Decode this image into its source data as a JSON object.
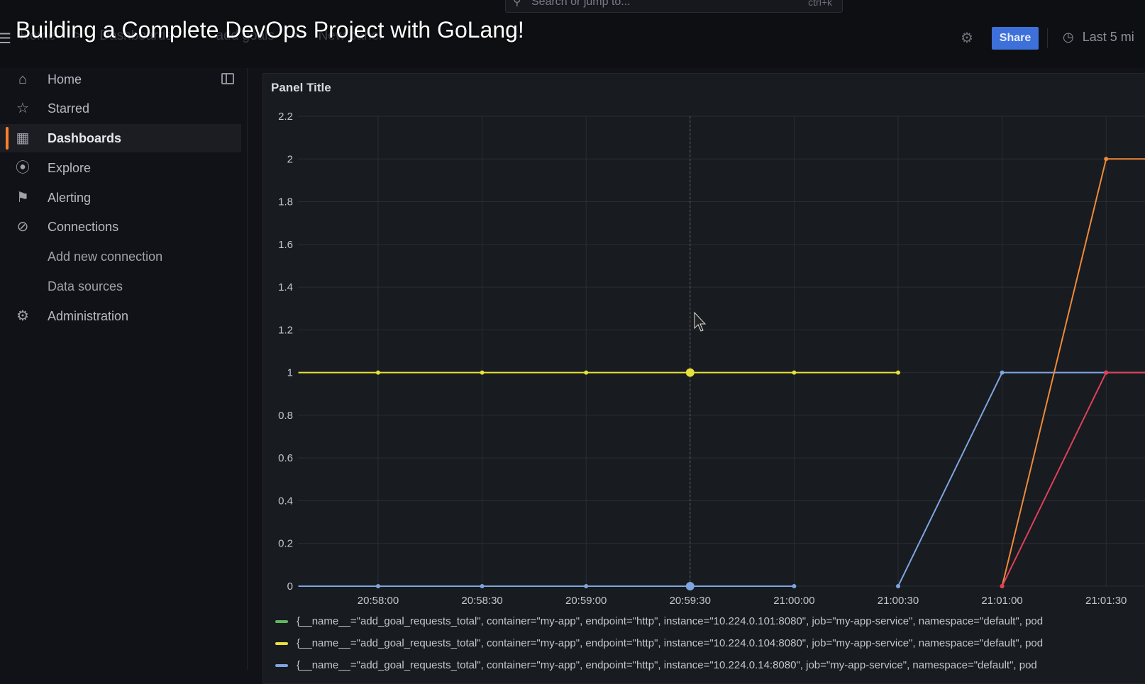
{
  "video_title": "Building a Complete DevOps Project with GoLang!",
  "topbar": {
    "search_placeholder": "Search or jump to...",
    "search_shortcut": "ctrl+k",
    "breadcrumb": [
      "Home",
      ">",
      "Dashboards",
      ">",
      "add goals",
      ">",
      "New panel"
    ],
    "share_label": "Share",
    "time_range": "Last 5 mi"
  },
  "sidebar": {
    "items": [
      {
        "label": "Home",
        "icon": "home-icon"
      },
      {
        "label": "Starred",
        "icon": "star-icon"
      },
      {
        "label": "Dashboards",
        "icon": "grid-icon",
        "active": true
      },
      {
        "label": "Explore",
        "icon": "compass-icon"
      },
      {
        "label": "Alerting",
        "icon": "bell-icon"
      },
      {
        "label": "Connections",
        "icon": "plug-icon"
      },
      {
        "label": "Add new connection"
      },
      {
        "label": "Data sources"
      },
      {
        "label": "Administration",
        "icon": "gear-icon"
      }
    ]
  },
  "panel": {
    "title": "Panel Title"
  },
  "colors": {
    "series_yellow": "#e6e13a",
    "series_blue": "#7ea5e0",
    "series_orange": "#ef8a3a",
    "series_red": "#e0405a",
    "series_green": "#5fb85f",
    "accent": "#ff7f2a",
    "share_button": "#3d71d9"
  },
  "chart_data": {
    "type": "line",
    "title": "Panel Title",
    "x_ticks": [
      "20:58:00",
      "20:58:30",
      "20:59:00",
      "20:59:30",
      "21:00:00",
      "21:00:30",
      "21:01:00",
      "21:01:30"
    ],
    "y_ticks": [
      "0",
      "0.2",
      "0.4",
      "0.6",
      "0.8",
      "1",
      "1.2",
      "1.4",
      "1.6",
      "1.8",
      "2",
      "2.2"
    ],
    "ylim": [
      0,
      2.2
    ],
    "grid": true,
    "legend_placement": "bottom",
    "series": [
      {
        "color": "yellow",
        "x": [
          "20:57:37",
          "20:58:00",
          "20:58:30",
          "20:59:00",
          "20:59:30",
          "21:00:00",
          "21:00:30"
        ],
        "values": [
          1,
          1,
          1,
          1,
          1,
          1,
          1
        ]
      },
      {
        "color": "blue",
        "x": [
          "20:57:37",
          "20:58:00",
          "20:58:30",
          "20:59:00",
          "20:59:30",
          "21:00:00"
        ],
        "values": [
          0,
          0,
          0,
          0,
          0,
          0
        ]
      },
      {
        "color": "blue",
        "x": [
          "21:00:30",
          "21:01:00",
          "21:01:30",
          "21:01:42"
        ],
        "values": [
          0,
          1,
          1,
          1
        ]
      },
      {
        "color": "orange",
        "x": [
          "21:01:00",
          "21:01:30",
          "21:01:42"
        ],
        "values": [
          0,
          2,
          2
        ]
      },
      {
        "color": "red",
        "x": [
          "21:01:00",
          "21:01:30",
          "21:01:42"
        ],
        "values": [
          0,
          1,
          1
        ]
      }
    ],
    "legend": [
      {
        "color": "green",
        "text": "{__name__=\"add_goal_requests_total\", container=\"my-app\", endpoint=\"http\", instance=\"10.224.0.101:8080\", job=\"my-app-service\", namespace=\"default\", pod"
      },
      {
        "color": "yellow",
        "text": "{__name__=\"add_goal_requests_total\", container=\"my-app\", endpoint=\"http\", instance=\"10.224.0.104:8080\", job=\"my-app-service\", namespace=\"default\", pod"
      },
      {
        "color": "blue",
        "text": "{__name__=\"add_goal_requests_total\", container=\"my-app\", endpoint=\"http\", instance=\"10.224.0.14:8080\", job=\"my-app-service\", namespace=\"default\", pod"
      }
    ]
  }
}
